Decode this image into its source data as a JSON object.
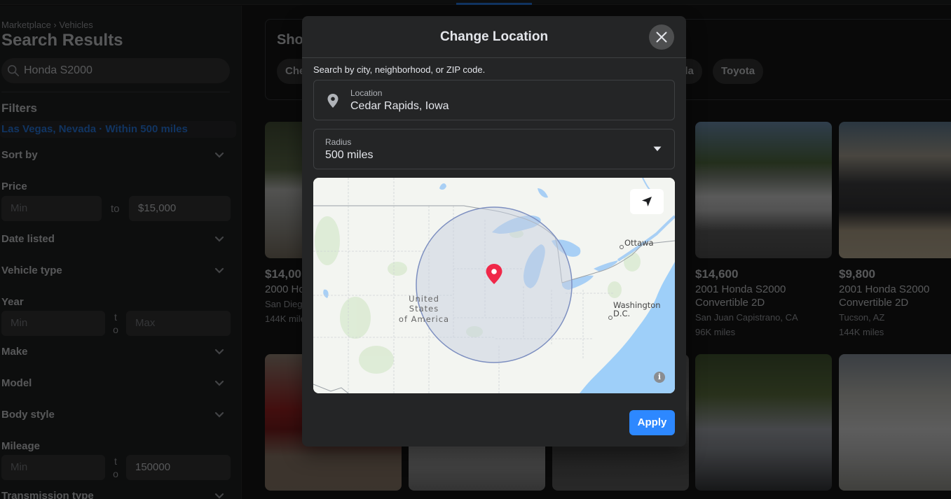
{
  "sidebar": {
    "breadcrumb": "Marketplace › Vehicles",
    "title": "Search Results",
    "search_value": "Honda S2000",
    "filters_title": "Filters",
    "location_filter": "Las Vegas, Nevada · Within 500 miles",
    "sort_by": "Sort by",
    "price_label": "Price",
    "price_min_placeholder": "Min",
    "price_to": "to",
    "price_max_value": "$15,000",
    "date_listed": "Date listed",
    "vehicle_type": "Vehicle type",
    "year_label": "Year",
    "year_min_placeholder": "Min",
    "year_to_t": "t",
    "year_to_o": "o",
    "year_max_placeholder": "Max",
    "make": "Make",
    "model": "Model",
    "body_style": "Body style",
    "mileage_label": "Mileage",
    "mileage_min_placeholder": "Min",
    "mileage_to_t": "t",
    "mileage_to_o": "o",
    "mileage_max_value": "150000",
    "transmission_type": "Transmission type"
  },
  "main": {
    "shortcuts_title": "Sho",
    "chips": [
      "Che",
      "sla",
      "Toyota"
    ],
    "listings": [
      {
        "price": "$14,00",
        "title": "2000 Ho",
        "location": "San Dieg",
        "miles": "144K mile"
      },
      {
        "price": "$14,600",
        "title": "2001 Honda S2000 Convertible 2D",
        "location": "San Juan Capistrano, CA",
        "miles": "96K miles"
      },
      {
        "price": "$9,800",
        "title": "2001 Honda S2000 Convertible 2D",
        "location": "Tucson, AZ",
        "miles": "144K miles"
      }
    ]
  },
  "modal": {
    "title": "Change Location",
    "hint": "Search by city, neighborhood, or ZIP code.",
    "location_label": "Location",
    "location_value": "Cedar Rapids, Iowa",
    "radius_label": "Radius",
    "radius_value": "500 miles",
    "map": {
      "country_label_1": "United",
      "country_label_2": "States",
      "country_label_3": "of America",
      "city_ottawa": "Ottawa",
      "city_washington_1": "Washington",
      "city_washington_2": "D.C.",
      "info": "i"
    },
    "apply_label": "Apply"
  },
  "colors": {
    "accent": "#2d88ff",
    "pin": "#f02849",
    "radius_fill": "#c8cfe0",
    "radius_stroke": "#7d8fc0"
  }
}
